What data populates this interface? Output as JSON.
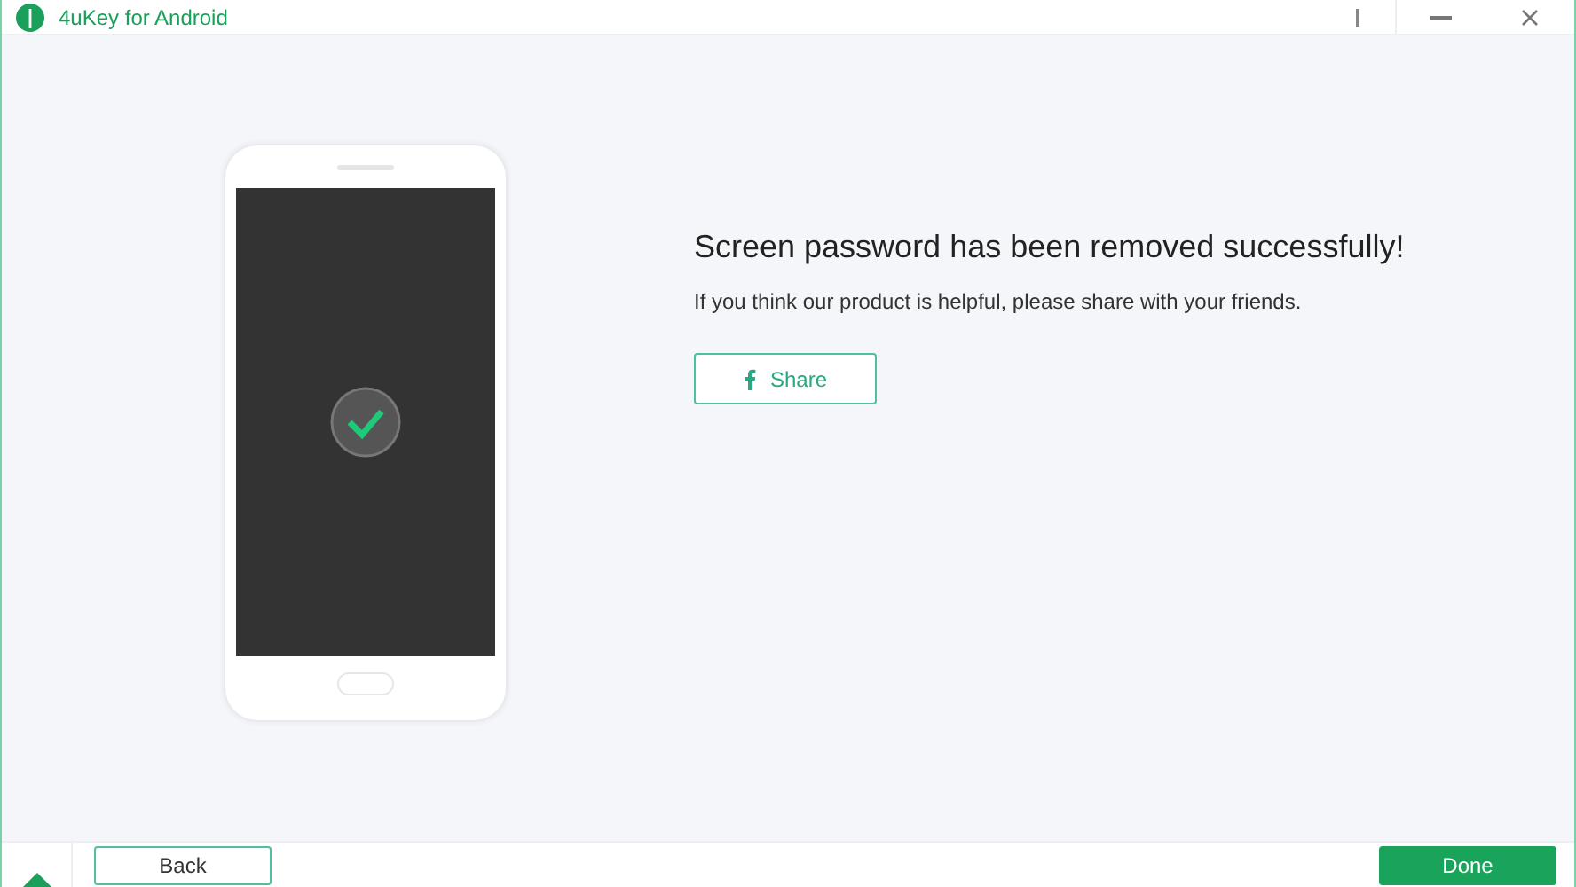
{
  "window": {
    "title": "4uKey for Android"
  },
  "result": {
    "heading": "Screen password has been removed successfully!",
    "message": "If you think our product is helpful, please share with your friends.",
    "share_button": "Share"
  },
  "footer": {
    "back_button": "Back",
    "done_button": "Done"
  }
}
